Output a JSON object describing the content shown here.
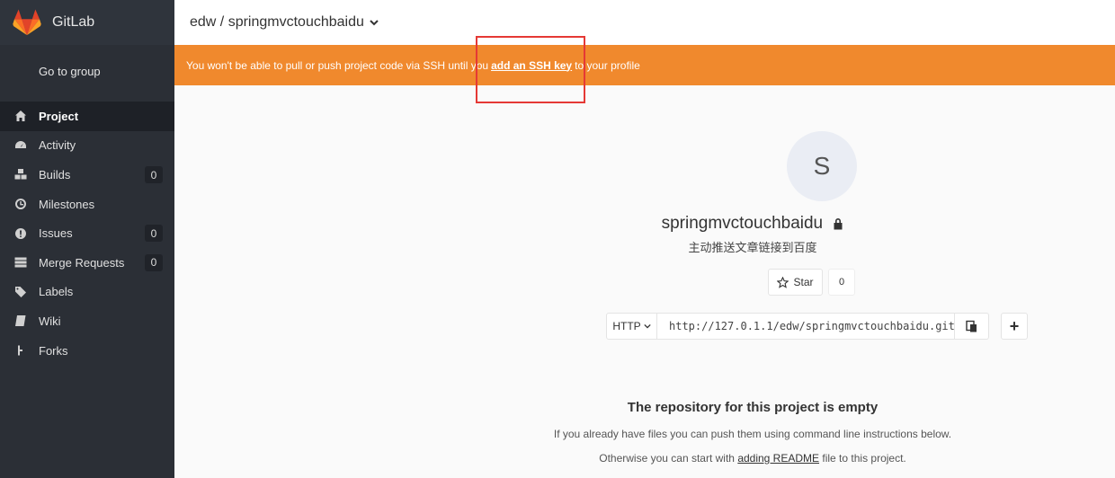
{
  "sidebar": {
    "brand": "GitLab",
    "go_to_group": "Go to group",
    "items": [
      {
        "label": "Project",
        "icon": "home-icon"
      },
      {
        "label": "Activity",
        "icon": "dashboard-icon"
      },
      {
        "label": "Builds",
        "icon": "cubes-icon",
        "count": "0"
      },
      {
        "label": "Milestones",
        "icon": "clock-icon"
      },
      {
        "label": "Issues",
        "icon": "exclamation-icon",
        "count": "0"
      },
      {
        "label": "Merge Requests",
        "icon": "list-icon",
        "count": "0"
      },
      {
        "label": "Labels",
        "icon": "tags-icon"
      },
      {
        "label": "Wiki",
        "icon": "book-icon"
      },
      {
        "label": "Forks",
        "icon": "fork-icon"
      }
    ]
  },
  "header": {
    "breadcrumb": "edw / springmvctouchbaidu"
  },
  "banner": {
    "before": "You won't be able to pull or push project code via SSH until you",
    "link": "add an SSH key",
    "after": "to your profile"
  },
  "project": {
    "avatar_letter": "S",
    "name": "springmvctouchbaidu",
    "description": "主动推送文章链接到百度",
    "star_label": "Star",
    "star_count": "0",
    "protocol": "HTTP",
    "clone_url": "http://127.0.1.1/edw/springmvctouchbaidu.git",
    "plus_label": "+"
  },
  "empty": {
    "title": "The repository for this project is empty",
    "line1": "If you already have files you can push them using command line instructions below.",
    "line2_before": "Otherwise you can start with",
    "line2_link": "adding README",
    "line2_after": "file to this project."
  },
  "colors": {
    "sidebar_bg": "#2b2f36",
    "banner_bg": "#f0892d",
    "highlight": "#e53935"
  }
}
